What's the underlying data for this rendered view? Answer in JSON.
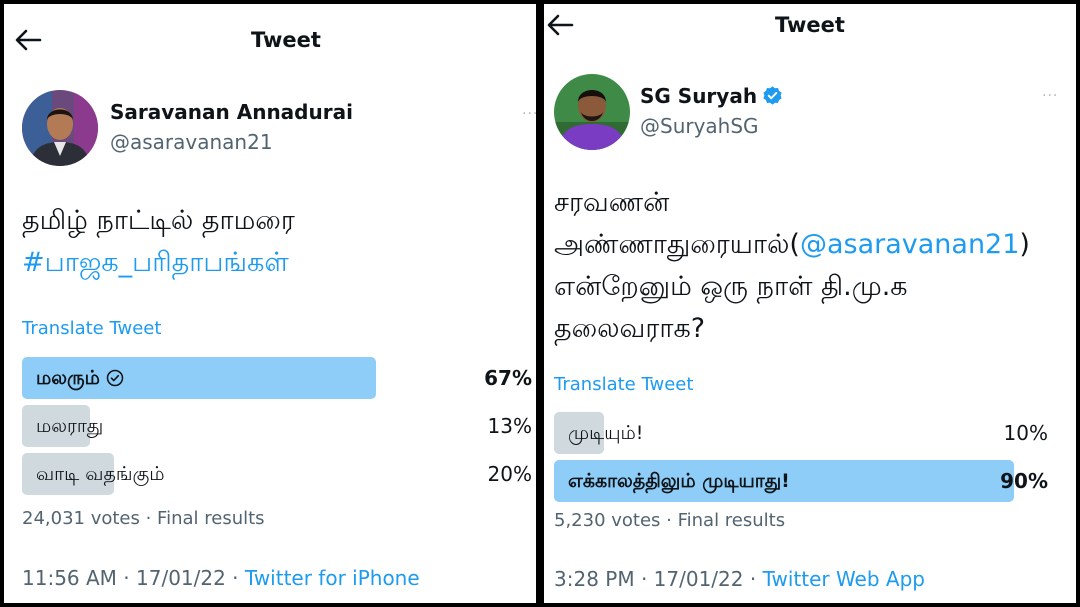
{
  "left": {
    "header_title": "Tweet",
    "author": {
      "name": "Saravanan Annadurai",
      "handle": "@asaravanan21"
    },
    "more_label": "···",
    "text_line1": "தமிழ் நாட்டில் தாமரை",
    "hashtag": "#பாஜக_பரிதாபங்கள்",
    "translate": "Translate Tweet",
    "poll": [
      {
        "label": "மலரும்",
        "percent": "67%",
        "fraction": 0.67,
        "winner": true
      },
      {
        "label": "மலராது",
        "percent": "13%",
        "fraction": 0.13,
        "winner": false
      },
      {
        "label": "வாடி வதங்கும்",
        "percent": "20%",
        "fraction": 0.2,
        "winner": false
      }
    ],
    "votes": "24,031 votes · Final results",
    "time": "11:56 AM · 17/01/22 · ",
    "source": "Twitter for iPhone"
  },
  "right": {
    "header_title": "Tweet",
    "author": {
      "name": "SG Suryah",
      "handle": "@SuryahSG",
      "verified": true
    },
    "more_label": "···",
    "text_line1": "சரவணன்",
    "text_line2_pre": "அண்ணாதுரையால்(",
    "mention": "@asaravanan21",
    "text_line2_post": ")",
    "text_line3": "என்றேனும் ஒரு நாள் தி.மு.க",
    "text_line4": "தலைவராக?",
    "translate": "Translate Tweet",
    "poll": [
      {
        "label": "முடியும்!",
        "percent": "10%",
        "fraction": 0.1,
        "winner": false
      },
      {
        "label": "எக்காலத்திலும் முடியாது!",
        "percent": "90%",
        "fraction": 0.9,
        "winner": true
      }
    ],
    "votes": "5,230 votes · Final results",
    "time": "3:28 PM · 17/01/22 · ",
    "source": "Twitter Web App"
  },
  "colors": {
    "link_blue": "#1d9bf0",
    "winner_bar": "#8ecdf8",
    "loser_bar": "#cfd9de",
    "muted": "#536471"
  },
  "icons": {
    "back": "arrow-left-icon",
    "verified": "verified-badge-icon",
    "check": "check-circle-icon"
  }
}
